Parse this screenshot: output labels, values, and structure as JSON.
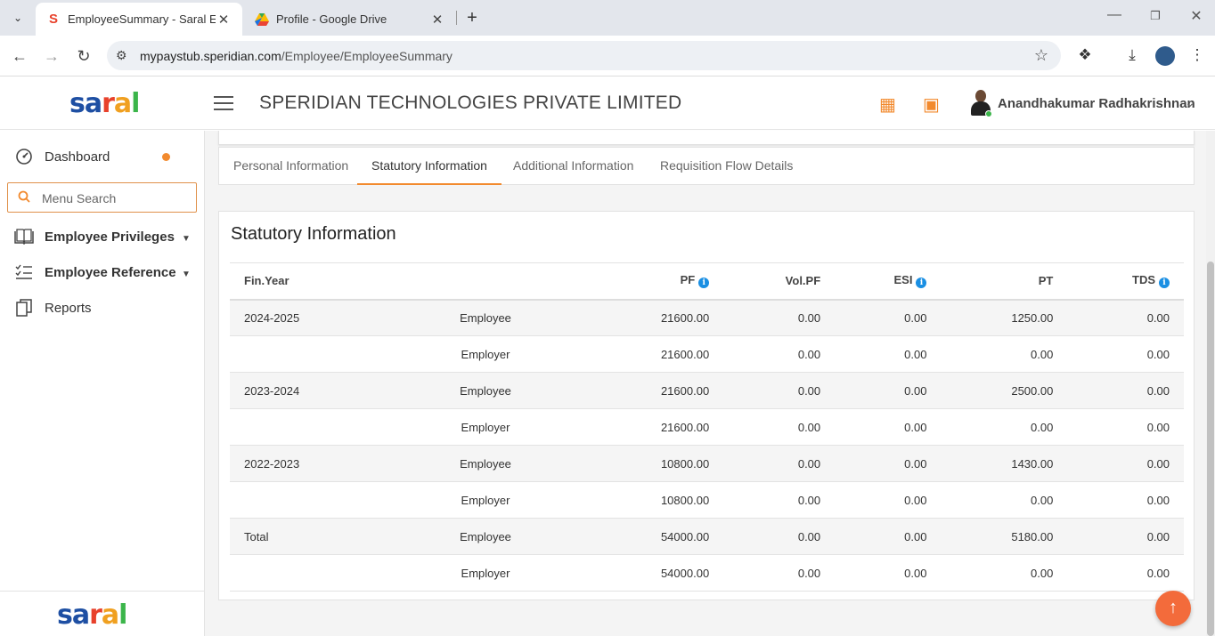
{
  "browser": {
    "tabs": [
      {
        "title": "EmployeeSummary - Saral ESS",
        "active": true,
        "favicon": "saral-s-icon"
      },
      {
        "title": "Profile - Google Drive",
        "active": false,
        "favicon": "google-drive-icon"
      }
    ],
    "url_host": "mypaystub.speridian.com",
    "url_path": "/Employee/EmployeeSummary"
  },
  "header": {
    "logo": [
      "s",
      "a",
      "r",
      "a",
      "l"
    ],
    "company": "SPERIDIAN TECHNOLOGIES PRIVATE LIMITED",
    "user_name": "Anandhakumar Radhakrishnan"
  },
  "sidebar": {
    "dashboard": "Dashboard",
    "search_placeholder": "Menu Search",
    "items": [
      {
        "label": "Employee Privileges",
        "icon": "book-icon"
      },
      {
        "label": "Employee Reference",
        "icon": "checklist-icon"
      },
      {
        "label": "Reports",
        "icon": "copy-icon"
      }
    ]
  },
  "subtabs": [
    "Personal Information",
    "Statutory Information",
    "Additional Information",
    "Requisition Flow Details"
  ],
  "active_subtab": "Statutory Information",
  "statutory": {
    "title": "Statutory Information",
    "columns": {
      "year": "Fin.Year",
      "pf": "PF",
      "volpf": "Vol.PF",
      "esi": "ESI",
      "pt": "PT",
      "tds": "TDS"
    },
    "rows": [
      {
        "year": "2024-2025",
        "type": "Employee",
        "pf": "21600.00",
        "volpf": "0.00",
        "esi": "0.00",
        "pt": "1250.00",
        "tds": "0.00"
      },
      {
        "year": "",
        "type": "Employer",
        "pf": "21600.00",
        "volpf": "0.00",
        "esi": "0.00",
        "pt": "0.00",
        "tds": "0.00"
      },
      {
        "year": "2023-2024",
        "type": "Employee",
        "pf": "21600.00",
        "volpf": "0.00",
        "esi": "0.00",
        "pt": "2500.00",
        "tds": "0.00"
      },
      {
        "year": "",
        "type": "Employer",
        "pf": "21600.00",
        "volpf": "0.00",
        "esi": "0.00",
        "pt": "0.00",
        "tds": "0.00"
      },
      {
        "year": "2022-2023",
        "type": "Employee",
        "pf": "10800.00",
        "volpf": "0.00",
        "esi": "0.00",
        "pt": "1430.00",
        "tds": "0.00"
      },
      {
        "year": "",
        "type": "Employer",
        "pf": "10800.00",
        "volpf": "0.00",
        "esi": "0.00",
        "pt": "0.00",
        "tds": "0.00"
      },
      {
        "year": "Total",
        "type": "Employee",
        "pf": "54000.00",
        "volpf": "0.00",
        "esi": "0.00",
        "pt": "5180.00",
        "tds": "0.00"
      },
      {
        "year": "",
        "type": "Employer",
        "pf": "54000.00",
        "volpf": "0.00",
        "esi": "0.00",
        "pt": "0.00",
        "tds": "0.00"
      }
    ]
  },
  "colors": {
    "accent": "#f28a2e",
    "info": "#1a8fe3",
    "scroll_top": "#f36b3b"
  }
}
